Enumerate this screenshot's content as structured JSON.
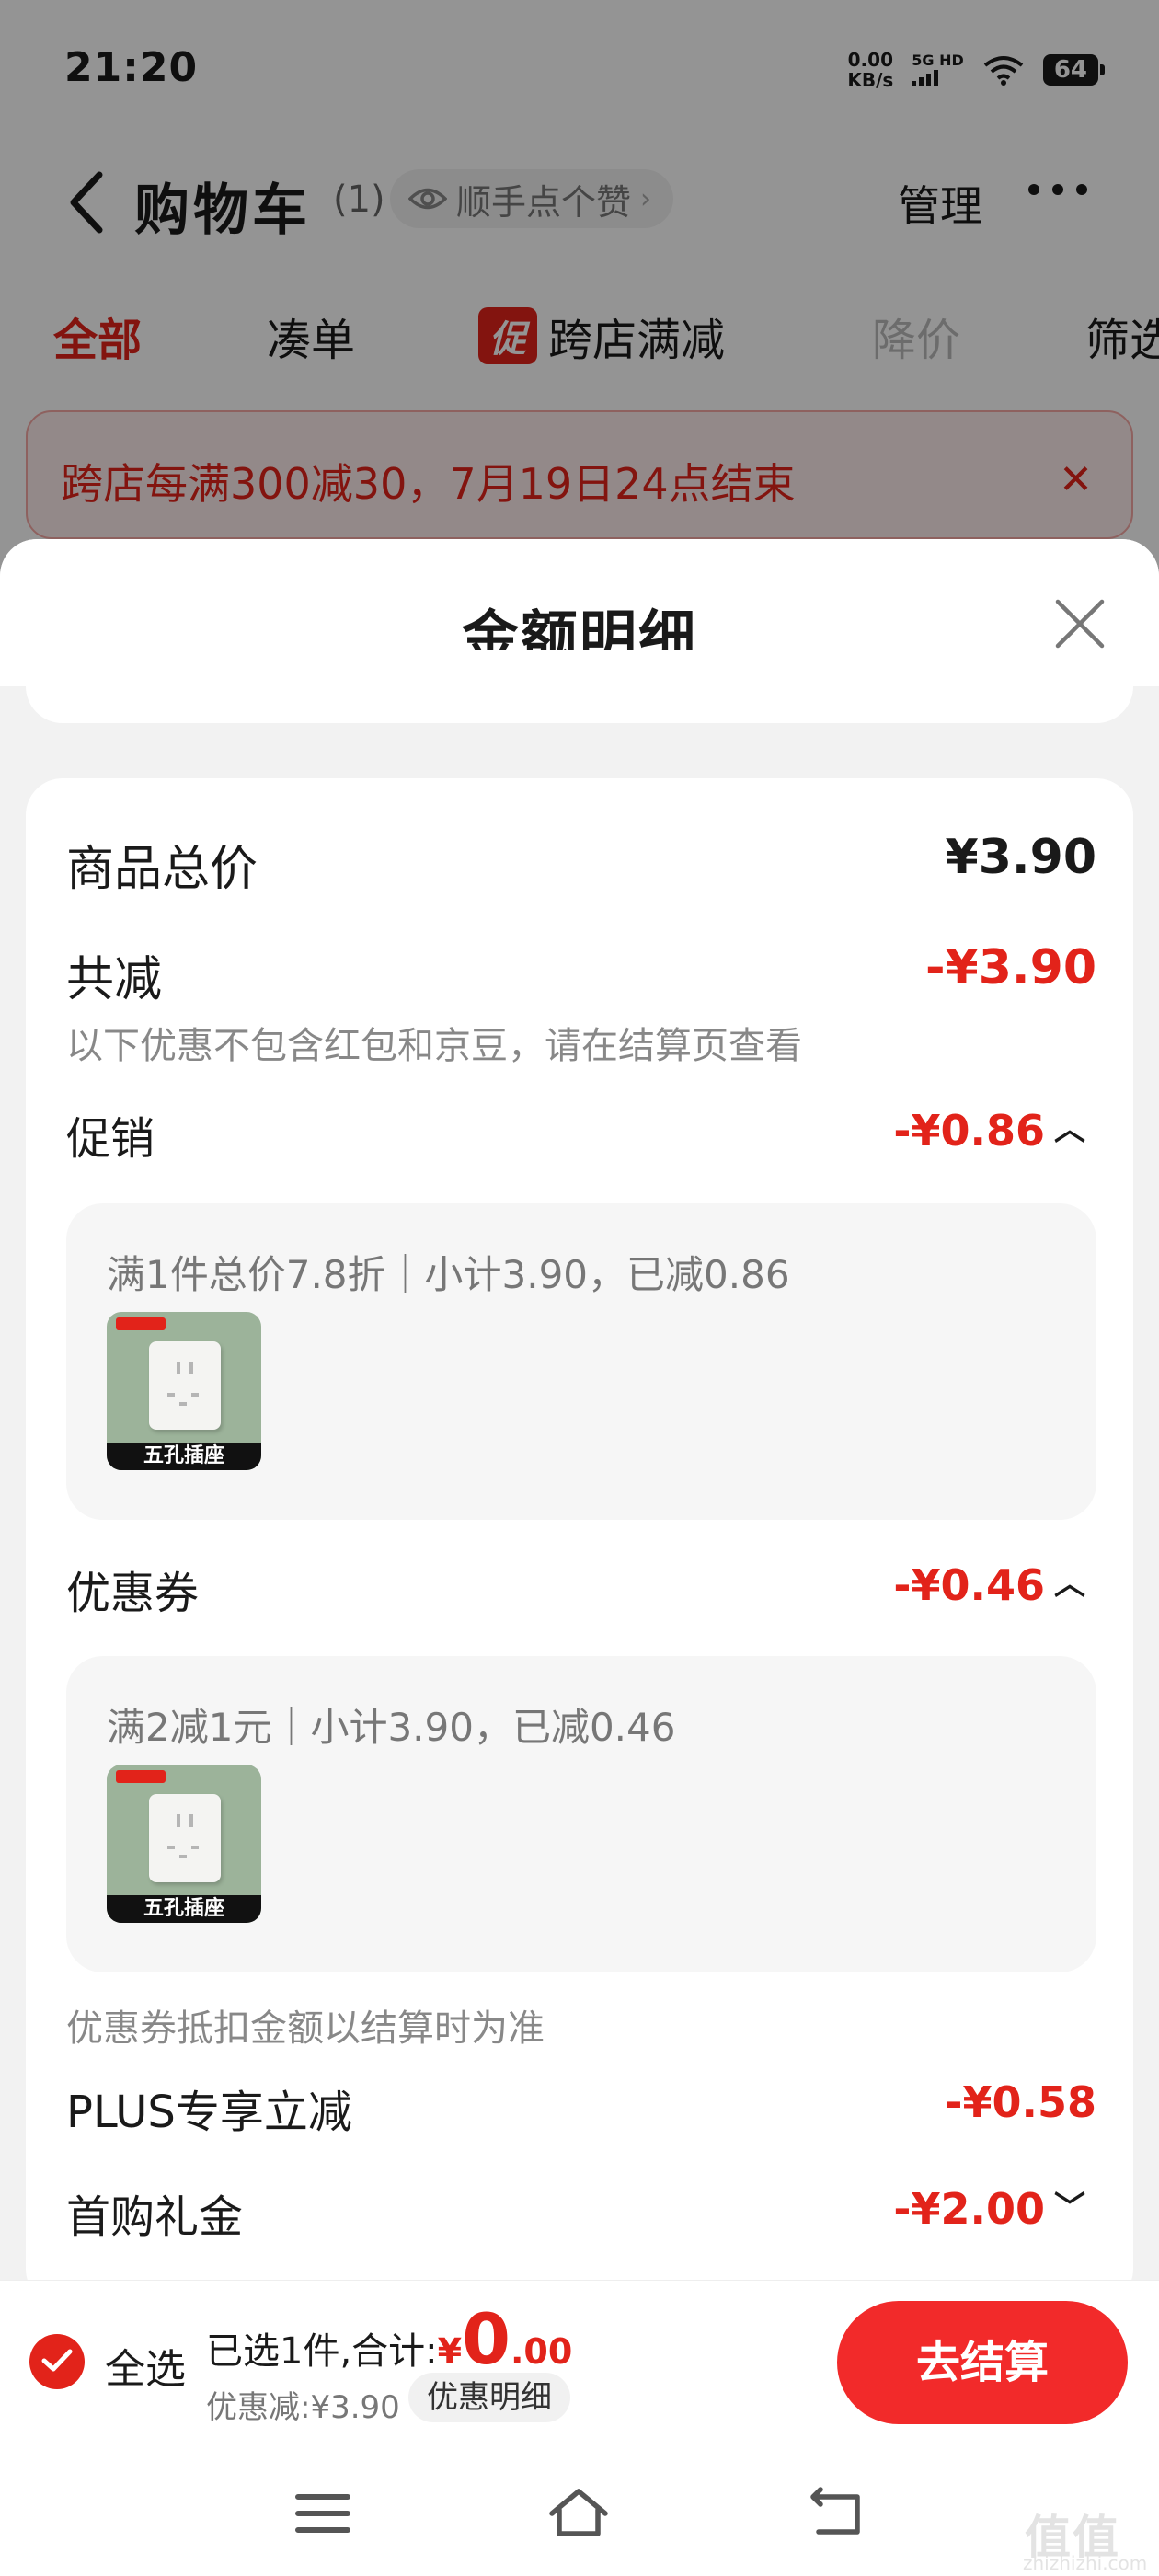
{
  "status": {
    "time": "21:20",
    "net_speed_value": "0.00",
    "net_speed_unit": "KB/s",
    "signal_label": "5G HD",
    "battery": "64"
  },
  "nav": {
    "title": "购物车",
    "count": "(1)",
    "like_label": "顺手点个赞",
    "manage": "管理"
  },
  "tabs": [
    {
      "label": "全部",
      "state": "active"
    },
    {
      "label": "凑单",
      "state": "normal"
    },
    {
      "label": "跨店满减",
      "badge": "促",
      "state": "normal"
    },
    {
      "label": "降价",
      "state": "muted"
    },
    {
      "label": "筛选",
      "state": "normal"
    }
  ],
  "banner": {
    "text": "跨店每满300减30，7月19日24点结束"
  },
  "sheet": {
    "title": "金额明细",
    "goods_total_label": "商品总价",
    "goods_total_value": "¥3.90",
    "total_discount_label": "共减",
    "total_discount_value": "-¥3.90",
    "total_discount_note": "以下优惠不包含红包和京豆，请在结算页查看",
    "promo_label": "促销",
    "promo_value": "-¥0.86",
    "promo_detail": "满1件总价7.8折｜小计3.90，已减0.86",
    "coupon_label": "优惠券",
    "coupon_value": "-¥0.46",
    "coupon_detail": "满2减1元｜小计3.90，已减0.46",
    "coupon_note": "优惠券抵扣金额以结算时为准",
    "plus_label": "PLUS专享立减",
    "plus_value": "-¥0.58",
    "first_gift_label": "首购礼金",
    "first_gift_value": "-¥2.00",
    "product_thumb_caption": "五孔插座"
  },
  "bottom": {
    "select_all": "全选",
    "selected_prefix": "已选1件,合计:",
    "currency": "¥",
    "total_int": "0",
    "total_dec": ".00",
    "discount_text": "优惠减:¥3.90",
    "detail_btn": "优惠明细",
    "checkout": "去结算"
  },
  "watermark": {
    "text": "值值值",
    "sub": "zhizhizhi.com"
  },
  "colors": {
    "accent": "#e2231a",
    "checkout": "#f22a2a"
  }
}
